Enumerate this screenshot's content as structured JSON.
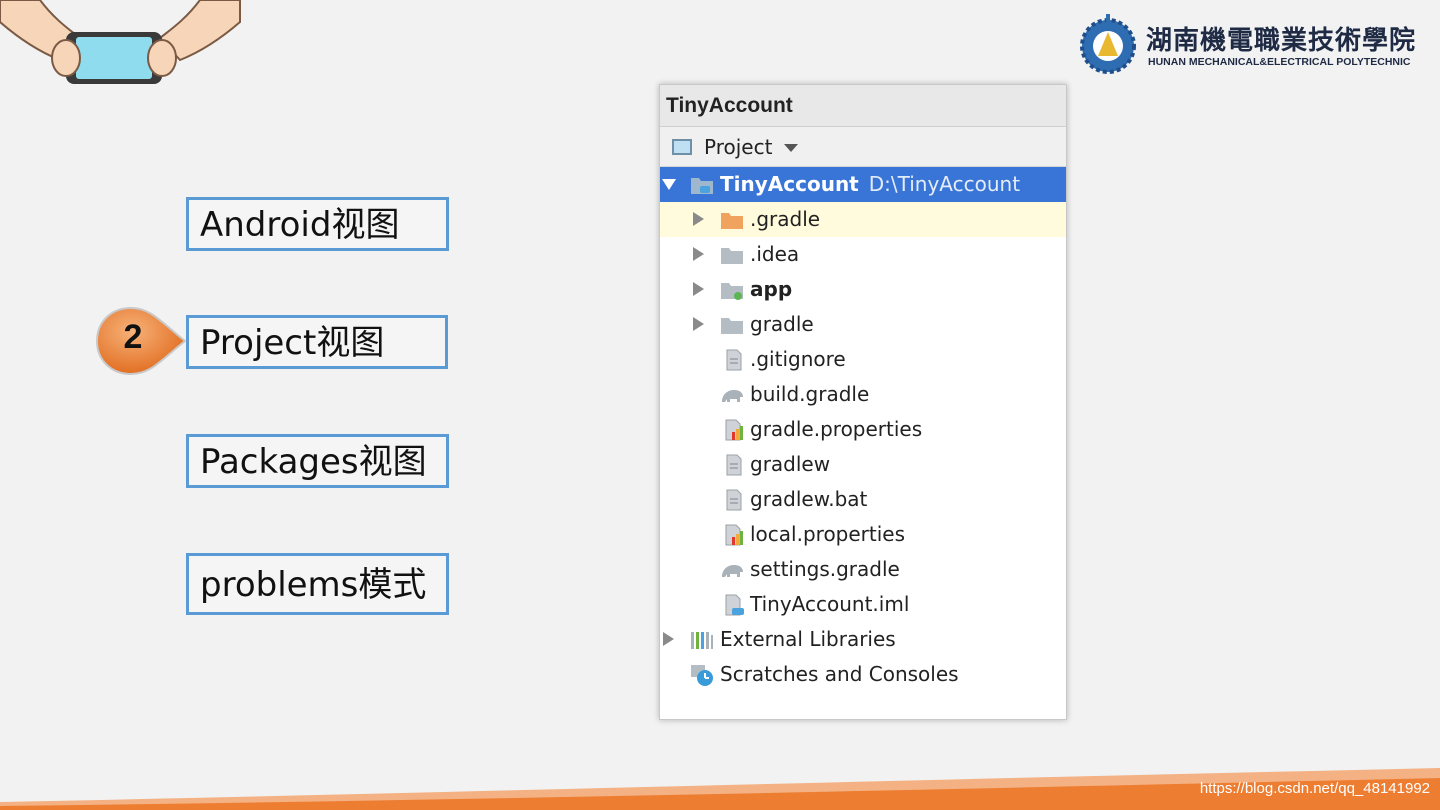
{
  "logo": {
    "name_cn": "湖南機電職業技術學院",
    "name_en": "HUNAN  MECHANICAL&ELECTRICAL POLYTECHNIC"
  },
  "menu": {
    "items": [
      "Android视图",
      "Project视图",
      "Packages视图",
      "problems模式"
    ],
    "step_number": "2"
  },
  "panel": {
    "title": "TinyAccount",
    "view_selector": "Project",
    "root": {
      "label": "TinyAccount",
      "path": "D:\\TinyAccount"
    },
    "items": [
      ".gradle",
      ".idea",
      "app",
      "gradle",
      ".gitignore",
      "build.gradle",
      "gradle.properties",
      "gradlew",
      "gradlew.bat",
      "local.properties",
      "settings.gradle",
      "TinyAccount.iml"
    ],
    "external": "External Libraries",
    "scratches": "Scratches and Consoles"
  },
  "watermark": "https://blog.csdn.net/qq_48141992",
  "colors": {
    "accent_blue": "#5b9bd5",
    "selection": "#3875d7",
    "step_orange": "#ed7d31",
    "highlight_row": "#fffbdc"
  }
}
